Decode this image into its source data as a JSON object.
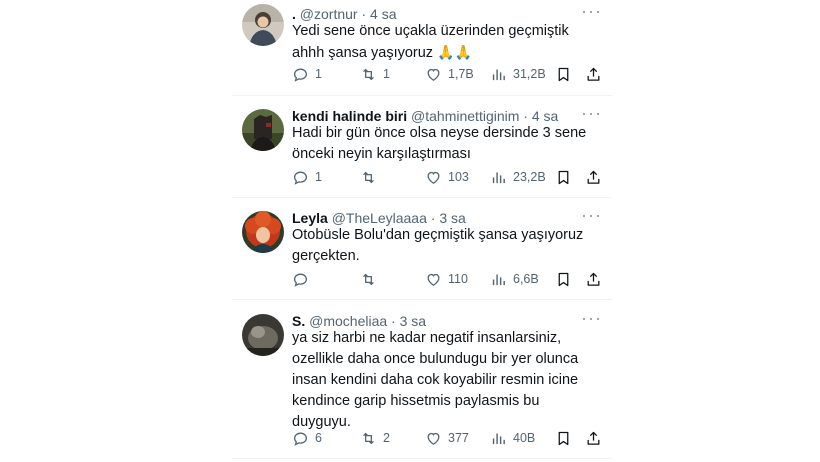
{
  "tweets": [
    {
      "name": ".",
      "handle": "@zortnur",
      "separator": "·",
      "time": "4 sa",
      "more": "···",
      "lines": [
        "Yedi sene önce uçakla üzerinden geçmiştik",
        "ahhh şansa yaşıyoruz"
      ],
      "emoji": "🙏🙏",
      "replies": "1",
      "retweets": "1",
      "likes": "1,7B",
      "views": "31,2B",
      "avatar": "person-photo"
    },
    {
      "name": "kendi halinde biri",
      "handle": "@tahminettiginim",
      "separator": "·",
      "time": "4 sa",
      "more": "···",
      "lines": [
        "Hadi bir gün önce olsa neyse dersinde 3 sene",
        "önceki neyin karşılaştırması"
      ],
      "replies": "1",
      "retweets": "",
      "likes": "103",
      "views": "23,2B",
      "avatar": "dark-figure-photo"
    },
    {
      "name": "Leyla",
      "handle": "@TheLeylaaaa",
      "separator": "·",
      "time": "3 sa",
      "more": "···",
      "lines": [
        "Otobüsle Bolu'dan geçmiştik şansa yaşıyoruz",
        "gerçekten."
      ],
      "replies": "",
      "retweets": "",
      "likes": "110",
      "views": "6,6B",
      "avatar": "red-hair-character"
    },
    {
      "name": "S.",
      "handle": "@mocheliaa",
      "separator": "·",
      "time": "3 sa",
      "more": "···",
      "lines": [
        "ya siz harbi ne kadar negatif insanlarsiniz,",
        "ozellikle daha once bulundugu bir yer olunca",
        "insan kendini daha cok koyabilir resmin icine",
        "kendince garip hissetmis paylasmis bu",
        "duyguyu."
      ],
      "replies": "6",
      "retweets": "2",
      "likes": "377",
      "views": "40B",
      "avatar": "dark-photo"
    }
  ],
  "icons": {
    "reply": "reply-icon",
    "retweet": "retweet-icon",
    "like": "heart-icon",
    "views": "views-icon",
    "bookmark": "bookmark-icon",
    "share": "share-icon"
  },
  "colors": {
    "text": "#0f1419",
    "muted": "#536471",
    "divider": "#eff3f4"
  }
}
